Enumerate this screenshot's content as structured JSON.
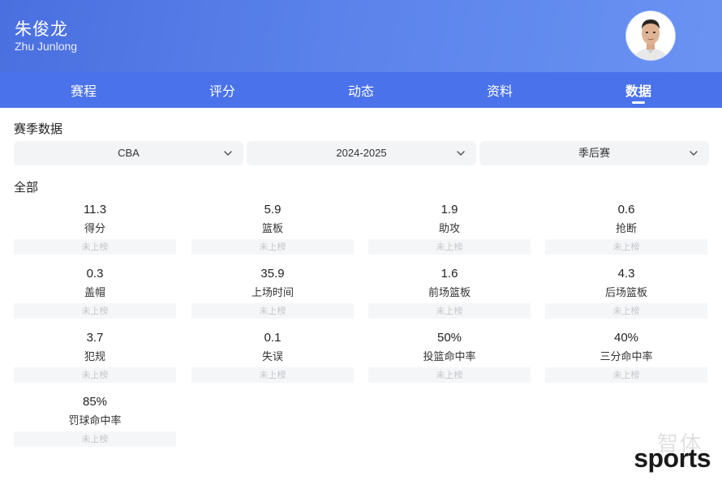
{
  "header": {
    "player_name": "朱俊龙",
    "player_name_en": "Zhu Junlong"
  },
  "tabs": [
    {
      "label": "赛程",
      "active": false
    },
    {
      "label": "评分",
      "active": false
    },
    {
      "label": "动态",
      "active": false
    },
    {
      "label": "资料",
      "active": false
    },
    {
      "label": "数据",
      "active": true
    }
  ],
  "season": {
    "title": "赛季数据",
    "filters": [
      {
        "value": "CBA"
      },
      {
        "value": "2024-2025"
      },
      {
        "value": "季后赛"
      }
    ]
  },
  "stats_section": {
    "title": "全部",
    "items": [
      {
        "value": "11.3",
        "label": "得分",
        "rank": "未上榜"
      },
      {
        "value": "5.9",
        "label": "篮板",
        "rank": "未上榜"
      },
      {
        "value": "1.9",
        "label": "助攻",
        "rank": "未上榜"
      },
      {
        "value": "0.6",
        "label": "抢断",
        "rank": "未上榜"
      },
      {
        "value": "0.3",
        "label": "盖帽",
        "rank": "未上榜"
      },
      {
        "value": "35.9",
        "label": "上场时间",
        "rank": "未上榜"
      },
      {
        "value": "1.6",
        "label": "前场篮板",
        "rank": "未上榜"
      },
      {
        "value": "4.3",
        "label": "后场篮板",
        "rank": "未上榜"
      },
      {
        "value": "3.7",
        "label": "犯规",
        "rank": "未上榜"
      },
      {
        "value": "0.1",
        "label": "失误",
        "rank": "未上榜"
      },
      {
        "value": "50%",
        "label": "投篮命中率",
        "rank": "未上榜"
      },
      {
        "value": "40%",
        "label": "三分命中率",
        "rank": "未上榜"
      },
      {
        "value": "85%",
        "label": "罚球命中率",
        "rank": "未上榜"
      }
    ]
  },
  "watermark": {
    "text": "sports",
    "faint_text": "智体"
  },
  "colors": {
    "header_start": "#4a6fe0",
    "header_end": "#6a93f3",
    "tabbar": "#4a72ea",
    "rank_bg": "#f5f6f8"
  },
  "icons": {
    "avatar": "player-photo",
    "select_arrow": "chevron-down-icon"
  }
}
